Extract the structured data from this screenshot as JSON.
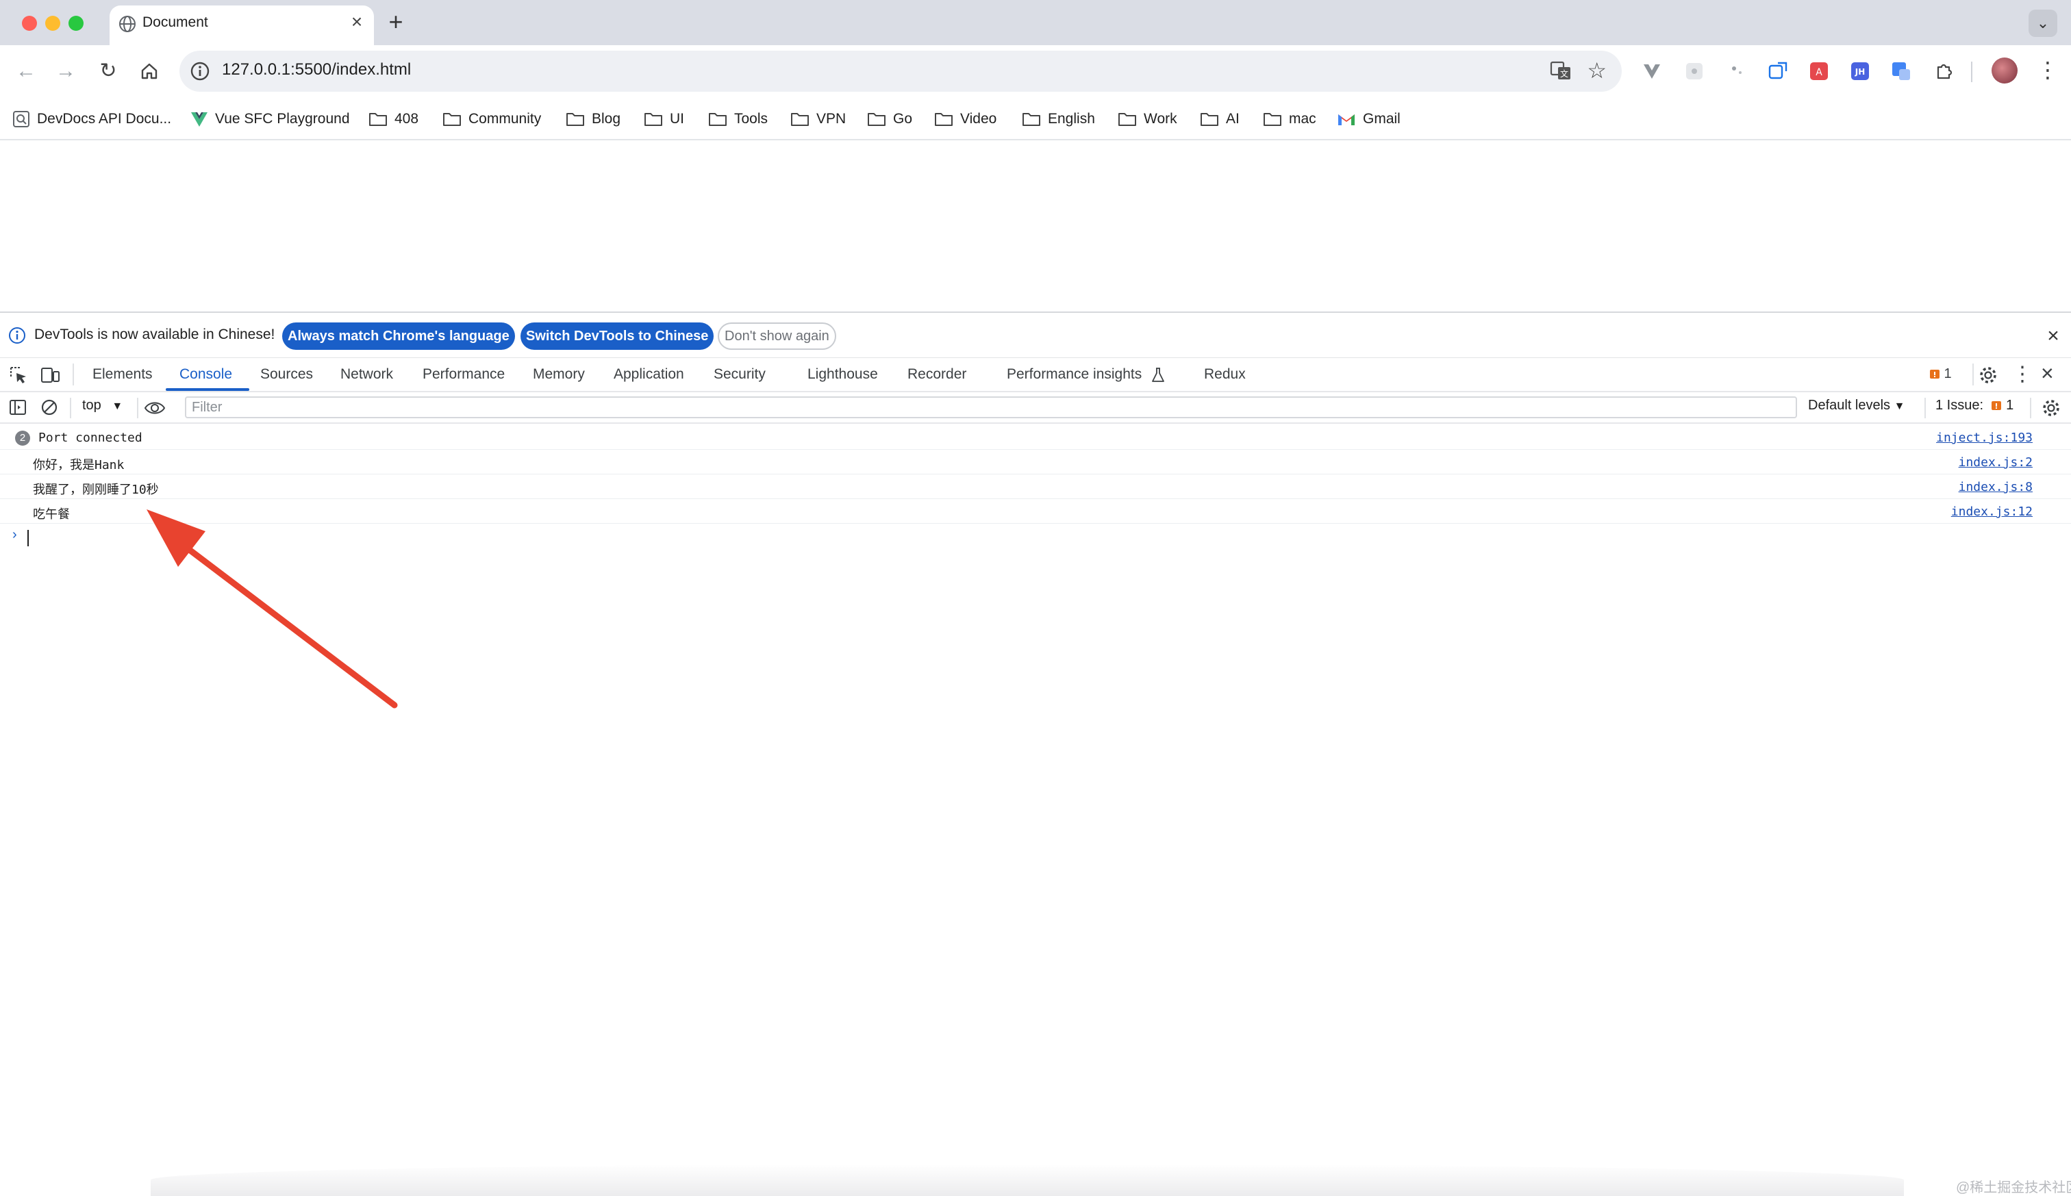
{
  "browser": {
    "tab": {
      "title": "Document"
    },
    "address": {
      "url": "127.0.0.1:5500/index.html"
    },
    "bookmarks": [
      {
        "label": "DevDocs API Docu...",
        "icon": "search-box-icon"
      },
      {
        "label": "Vue SFC Playground",
        "icon": "vue-logo-icon"
      },
      {
        "label": "408",
        "icon": "folder-icon"
      },
      {
        "label": "Community",
        "icon": "folder-icon"
      },
      {
        "label": "Blog",
        "icon": "folder-icon"
      },
      {
        "label": "UI",
        "icon": "folder-icon"
      },
      {
        "label": "Tools",
        "icon": "folder-icon"
      },
      {
        "label": "VPN",
        "icon": "folder-icon"
      },
      {
        "label": "Go",
        "icon": "folder-icon"
      },
      {
        "label": "Video",
        "icon": "folder-icon"
      },
      {
        "label": "English",
        "icon": "folder-icon"
      },
      {
        "label": "Work",
        "icon": "folder-icon"
      },
      {
        "label": "AI",
        "icon": "folder-icon"
      },
      {
        "label": "mac",
        "icon": "folder-icon"
      },
      {
        "label": "Gmail",
        "icon": "gmail-icon"
      }
    ]
  },
  "devtools": {
    "infobar": {
      "message": "DevTools is now available in Chinese!",
      "btn_match": "Always match Chrome's language",
      "btn_switch": "Switch DevTools to Chinese",
      "btn_dismiss": "Don't show again"
    },
    "tabs": [
      "Elements",
      "Console",
      "Sources",
      "Network",
      "Performance",
      "Memory",
      "Application",
      "Security",
      "Lighthouse",
      "Recorder",
      "Performance insights",
      "Redux"
    ],
    "active_tab": "Console",
    "issues_count": "1",
    "console_toolbar": {
      "context": "top",
      "filter_placeholder": "Filter",
      "levels": "Default levels",
      "issues_label": "1 Issue:",
      "issues_count": "1"
    },
    "messages": [
      {
        "repeat": "2",
        "text": "Port connected",
        "source": "inject.js:193"
      },
      {
        "text": "你好，我是Hank",
        "source": "index.js:2"
      },
      {
        "text": "我醒了，刚刚睡了10秒",
        "source": "index.js:8"
      },
      {
        "text": "吃午餐",
        "source": "index.js:12"
      }
    ],
    "prompt": "›"
  },
  "colors": {
    "accent": "#1a5fc8",
    "annotation_arrow": "#e8432f",
    "issue_badge": "#e8711a"
  },
  "watermark": "@稀土掘金技术社区"
}
